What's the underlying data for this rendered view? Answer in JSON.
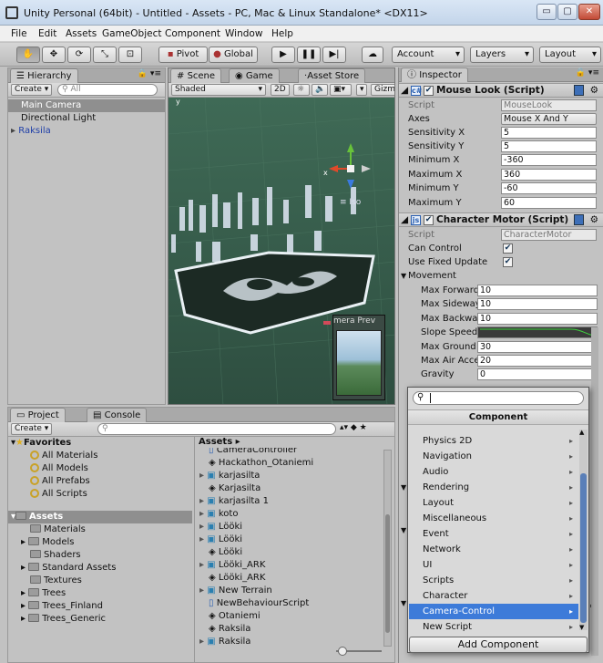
{
  "window": {
    "title": "Unity Personal (64bit) - Untitled - Assets - PC, Mac & Linux Standalone* <DX11>",
    "min": "▭",
    "max": "▢",
    "close": "✕"
  },
  "menu": [
    "File",
    "Edit",
    "Assets",
    "GameObject",
    "Component",
    "Window",
    "Help"
  ],
  "toolbar": {
    "tools": [
      "hand-icon",
      "move-icon",
      "rotate-icon",
      "scale-icon",
      "rect-icon"
    ],
    "tool_glyphs": [
      "✋",
      "✥",
      "⟳",
      "⤡",
      "⊡"
    ],
    "pivot": "Pivot",
    "global": "Global",
    "play": "▶",
    "pause": "❚❚",
    "step": "▶|",
    "cloud": "☁",
    "account": "Account",
    "layers": "Layers",
    "layout": "Layout",
    "dropdown": "▾"
  },
  "hierarchy": {
    "tab": "Hierarchy",
    "create": "Create ▾",
    "search_placeholder": "All",
    "items": [
      {
        "label": "Main Camera",
        "selected": true
      },
      {
        "label": "Directional Light",
        "selected": false
      },
      {
        "label": "Raksila",
        "selected": false,
        "prefab": true
      }
    ]
  },
  "scene": {
    "tabs": [
      "Scene",
      "Game",
      "Asset Store"
    ],
    "shading": "Shaded",
    "mode2d": "2D",
    "gizmos": "Gizm",
    "iso": "≡ Iso",
    "camera_preview_label": "mera Prev",
    "colors": {
      "ground": "#3b5e4c",
      "building": "#c8d4dc"
    }
  },
  "inspector": {
    "tab": "Inspector",
    "mouse_look": {
      "title": "Mouse Look (Script)",
      "fields": [
        {
          "label": "Script",
          "value": "MouseLook",
          "kind": "obj"
        },
        {
          "label": "Axes",
          "value": "Mouse X And Y",
          "kind": "enum"
        },
        {
          "label": "Sensitivity X",
          "value": "5"
        },
        {
          "label": "Sensitivity Y",
          "value": "5"
        },
        {
          "label": "Minimum X",
          "value": "-360"
        },
        {
          "label": "Maximum X",
          "value": "360"
        },
        {
          "label": "Minimum Y",
          "value": "-60"
        },
        {
          "label": "Maximum Y",
          "value": "60"
        }
      ]
    },
    "character_motor": {
      "title": "Character Motor (Script)",
      "script_label": "Script",
      "script_value": "CharacterMotor",
      "can_control": "Can Control",
      "use_fixed_update": "Use Fixed Update",
      "movement": "Movement",
      "fields": [
        {
          "label": "Max Forward Spee",
          "value": "10"
        },
        {
          "label": "Max Sideways Spe",
          "value": "10"
        },
        {
          "label": "Max Backwards S",
          "value": "10"
        },
        {
          "label": "Slope Speed Multi",
          "value": "",
          "curve": true
        },
        {
          "label": "Max Ground Accel",
          "value": "30"
        },
        {
          "label": "Max Air Accelerati",
          "value": "20"
        },
        {
          "label": "Gravity",
          "value": "0"
        }
      ]
    }
  },
  "project": {
    "tabs": [
      "Project",
      "Console"
    ],
    "create": "Create ▾",
    "favorites_label": "Favorites",
    "favorites": [
      "All Materials",
      "All Models",
      "All Prefabs",
      "All Scripts"
    ],
    "assets_label": "Assets",
    "folders": [
      {
        "label": "Materials",
        "expandable": false
      },
      {
        "label": "Models",
        "expandable": true
      },
      {
        "label": "Shaders",
        "expandable": false
      },
      {
        "label": "Standard Assets",
        "expandable": true
      },
      {
        "label": "Textures",
        "expandable": false
      },
      {
        "label": "Trees",
        "expandable": true
      },
      {
        "label": "Trees_Finland",
        "expandable": true
      },
      {
        "label": "Trees_Generic",
        "expandable": true
      }
    ],
    "breadcrumb": "Assets ▸",
    "files": [
      {
        "label": "CameraController",
        "icon": "script"
      },
      {
        "label": "Hackathon_Otaniemi",
        "icon": "unity"
      },
      {
        "label": "karjasilta",
        "icon": "prefab",
        "expandable": true
      },
      {
        "label": "Karjasilta",
        "icon": "unity"
      },
      {
        "label": "karjasilta 1",
        "icon": "prefab",
        "expandable": true
      },
      {
        "label": "koto",
        "icon": "prefab",
        "expandable": true
      },
      {
        "label": "Lööki",
        "icon": "prefab",
        "expandable": true
      },
      {
        "label": "Lööki",
        "icon": "prefab",
        "expandable": true
      },
      {
        "label": "Lööki",
        "icon": "unity"
      },
      {
        "label": "Lööki_ARK",
        "icon": "prefab",
        "expandable": true
      },
      {
        "label": "Lööki_ARK",
        "icon": "unity"
      },
      {
        "label": "New Terrain",
        "icon": "prefab",
        "expandable": true
      },
      {
        "label": "NewBehaviourScript",
        "icon": "script"
      },
      {
        "label": "Otaniemi",
        "icon": "unity"
      },
      {
        "label": "Raksila",
        "icon": "unity"
      },
      {
        "label": "Raksila",
        "icon": "prefab",
        "expandable": true
      }
    ]
  },
  "component_popup": {
    "header": "Component",
    "items": [
      {
        "label": "Physics 2D",
        "selected": false
      },
      {
        "label": "Navigation",
        "selected": false
      },
      {
        "label": "Audio",
        "selected": false
      },
      {
        "label": "Rendering",
        "selected": false
      },
      {
        "label": "Layout",
        "selected": false
      },
      {
        "label": "Miscellaneous",
        "selected": false
      },
      {
        "label": "Event",
        "selected": false
      },
      {
        "label": "Network",
        "selected": false
      },
      {
        "label": "UI",
        "selected": false
      },
      {
        "label": "Scripts",
        "selected": false
      },
      {
        "label": "Character",
        "selected": false
      },
      {
        "label": "Camera-Control",
        "selected": true
      },
      {
        "label": "New Script",
        "selected": false
      }
    ],
    "add_component": "Add Component"
  }
}
